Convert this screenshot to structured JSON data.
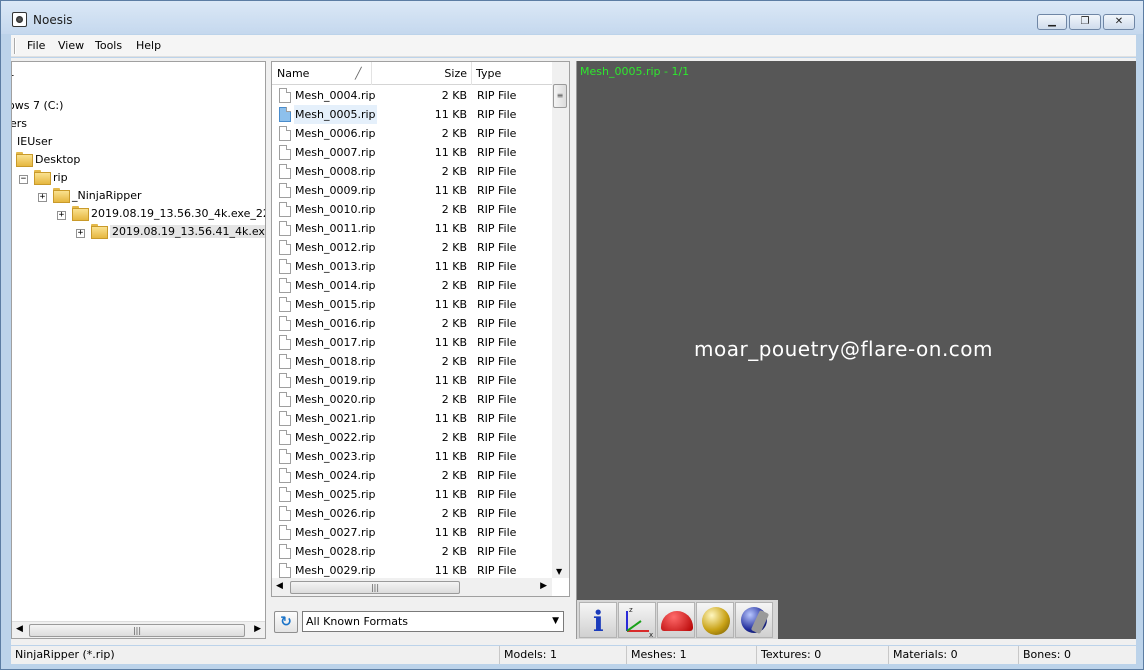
{
  "window": {
    "title": "Noesis"
  },
  "menu": [
    "File",
    "View",
    "Tools",
    "Help"
  ],
  "tree": {
    "items": [
      {
        "label": "r",
        "expander": "",
        "icon": "none"
      },
      {
        "label": "ows 7 (C:)",
        "expander": "",
        "icon": "none"
      },
      {
        "label": "ers",
        "expander": "",
        "icon": "none"
      },
      {
        "label": "IEUser",
        "expander": "",
        "icon": "none"
      },
      {
        "label": "Desktop",
        "expander": "",
        "icon": "desktop-folder"
      },
      {
        "label": "rip",
        "expander": "−",
        "icon": "folder"
      },
      {
        "label": "_NinjaRipper",
        "expander": "+",
        "icon": "folder"
      },
      {
        "label": "2019.08.19_13.56.30_4k.exe_2276",
        "expander": "+",
        "icon": "folder"
      },
      {
        "label": "2019.08.19_13.56.41_4k.exe",
        "expander": "+",
        "icon": "folder",
        "selected": true
      }
    ]
  },
  "files": {
    "headers": {
      "name": "Name",
      "size": "Size",
      "type": "Type"
    },
    "rows": [
      {
        "name": "Mesh_0004.rip",
        "size": "2 KB",
        "type": "RIP File"
      },
      {
        "name": "Mesh_0005.rip",
        "size": "11 KB",
        "type": "RIP File",
        "selected": true
      },
      {
        "name": "Mesh_0006.rip",
        "size": "2 KB",
        "type": "RIP File"
      },
      {
        "name": "Mesh_0007.rip",
        "size": "11 KB",
        "type": "RIP File"
      },
      {
        "name": "Mesh_0008.rip",
        "size": "2 KB",
        "type": "RIP File"
      },
      {
        "name": "Mesh_0009.rip",
        "size": "11 KB",
        "type": "RIP File"
      },
      {
        "name": "Mesh_0010.rip",
        "size": "2 KB",
        "type": "RIP File"
      },
      {
        "name": "Mesh_0011.rip",
        "size": "11 KB",
        "type": "RIP File"
      },
      {
        "name": "Mesh_0012.rip",
        "size": "2 KB",
        "type": "RIP File"
      },
      {
        "name": "Mesh_0013.rip",
        "size": "11 KB",
        "type": "RIP File"
      },
      {
        "name": "Mesh_0014.rip",
        "size": "2 KB",
        "type": "RIP File"
      },
      {
        "name": "Mesh_0015.rip",
        "size": "11 KB",
        "type": "RIP File"
      },
      {
        "name": "Mesh_0016.rip",
        "size": "2 KB",
        "type": "RIP File"
      },
      {
        "name": "Mesh_0017.rip",
        "size": "11 KB",
        "type": "RIP File"
      },
      {
        "name": "Mesh_0018.rip",
        "size": "2 KB",
        "type": "RIP File"
      },
      {
        "name": "Mesh_0019.rip",
        "size": "11 KB",
        "type": "RIP File"
      },
      {
        "name": "Mesh_0020.rip",
        "size": "2 KB",
        "type": "RIP File"
      },
      {
        "name": "Mesh_0021.rip",
        "size": "11 KB",
        "type": "RIP File"
      },
      {
        "name": "Mesh_0022.rip",
        "size": "2 KB",
        "type": "RIP File"
      },
      {
        "name": "Mesh_0023.rip",
        "size": "11 KB",
        "type": "RIP File"
      },
      {
        "name": "Mesh_0024.rip",
        "size": "2 KB",
        "type": "RIP File"
      },
      {
        "name": "Mesh_0025.rip",
        "size": "11 KB",
        "type": "RIP File"
      },
      {
        "name": "Mesh_0026.rip",
        "size": "2 KB",
        "type": "RIP File"
      },
      {
        "name": "Mesh_0027.rip",
        "size": "11 KB",
        "type": "RIP File"
      },
      {
        "name": "Mesh_0028.rip",
        "size": "2 KB",
        "type": "RIP File"
      },
      {
        "name": "Mesh_0029.rip",
        "size": "11 KB",
        "type": "RIP File"
      }
    ]
  },
  "filter": {
    "selected": "All Known Formats"
  },
  "preview": {
    "label": "Mesh_0005.rip - 1/1",
    "rendered_text": "moar_pouetry@flare-on.com",
    "label_color": "#2ee82e",
    "background": "#575757"
  },
  "toolbar": {
    "icons": [
      "info-icon",
      "axes-icon",
      "dome-icon",
      "sphere-icon",
      "skeleton-icon"
    ]
  },
  "status": {
    "format": "NinjaRipper (*.rip)",
    "models": "Models: 1",
    "meshes": "Meshes: 1",
    "textures": "Textures: 0",
    "materials": "Materials: 0",
    "bones": "Bones: 0"
  }
}
